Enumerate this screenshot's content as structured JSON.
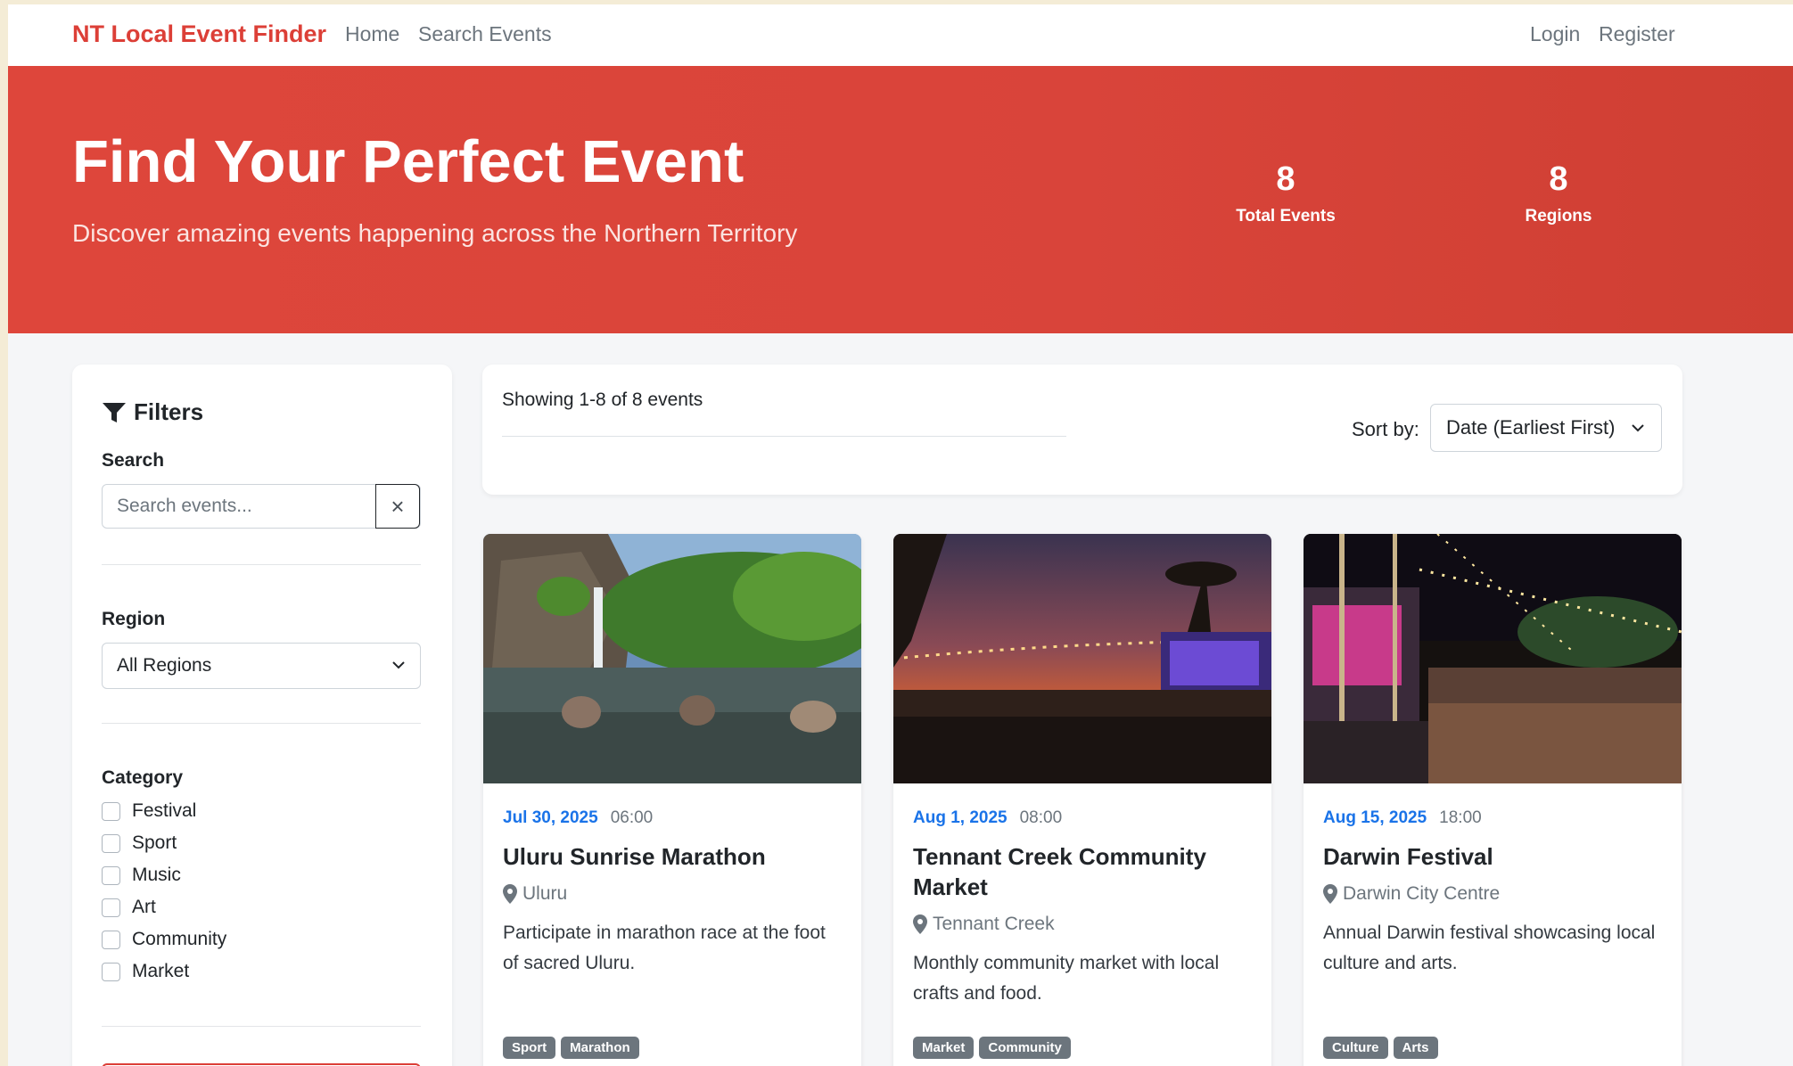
{
  "navbar": {
    "brand": "NT Local Event Finder",
    "links": [
      "Home",
      "Search Events"
    ],
    "login": "Login",
    "register": "Register"
  },
  "hero": {
    "title": "Find Your Perfect Event",
    "subtitle": "Discover amazing events happening across the Northern Territory",
    "stats": [
      {
        "value": "8",
        "label": "Total Events"
      },
      {
        "value": "8",
        "label": "Regions"
      }
    ]
  },
  "filters": {
    "title": "Filters",
    "search_label": "Search",
    "search_placeholder": "Search events...",
    "search_value": "",
    "clear_symbol": "×",
    "region_label": "Region",
    "region_value": "All Regions",
    "category_label": "Category",
    "categories": [
      "Festival",
      "Sport",
      "Music",
      "Art",
      "Community",
      "Market"
    ]
  },
  "results": {
    "showing": "Showing 1-8 of 8 events",
    "sort_label": "Sort by:",
    "sort_value": "Date (Earliest First)"
  },
  "events": [
    {
      "date": "Jul 30, 2025",
      "time": "06:00",
      "title": "Uluru Sunrise Marathon",
      "location": "Uluru",
      "description": "Participate in marathon race at the foot of sacred Uluru.",
      "tags": [
        "Sport",
        "Marathon"
      ]
    },
    {
      "date": "Aug 1, 2025",
      "time": "08:00",
      "title": "Tennant Creek Community Market",
      "location": "Tennant Creek",
      "description": "Monthly community market with local crafts and food.",
      "tags": [
        "Market",
        "Community"
      ]
    },
    {
      "date": "Aug 15, 2025",
      "time": "18:00",
      "title": "Darwin Festival",
      "location": "Darwin City Centre",
      "description": "Annual Darwin festival showcasing local culture and arts.",
      "tags": [
        "Culture",
        "Arts"
      ]
    }
  ],
  "colors": {
    "brand": "#dc3f37",
    "hero_bg": "#d9443a",
    "date_blue": "#1a73e8",
    "tag_bg": "#6c757d"
  }
}
